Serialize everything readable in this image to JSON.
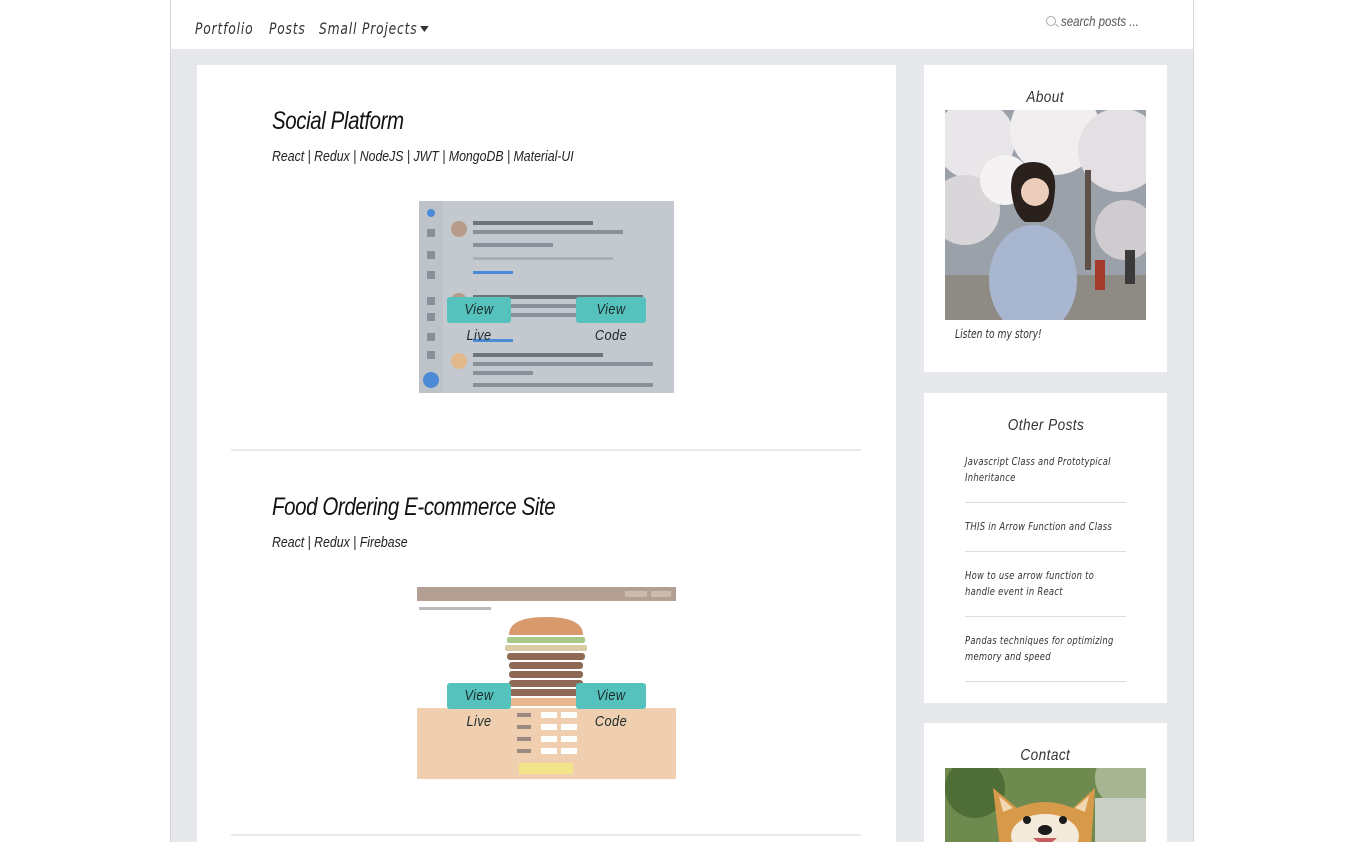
{
  "nav": {
    "items": [
      "Portfolio",
      "Posts",
      "Small Projects"
    ],
    "search_placeholder": "search posts ..."
  },
  "projects": [
    {
      "title": "Social Platform",
      "tech": "React | Redux | NodeJS | JWT | MongoDB | Material-UI",
      "view_live": "View Live",
      "view_code": "View Code"
    },
    {
      "title": "Food Ordering E-commerce Site",
      "tech": "React | Redux | Firebase",
      "view_live": "View Live",
      "view_code": "View Code"
    }
  ],
  "sidebar": {
    "about": {
      "title": "About",
      "link": "Listen to my story!"
    },
    "other_posts": {
      "title": "Other Posts",
      "items": [
        "Javascript Class and Prototypical Inheritance",
        "THIS in Arrow Function and Class",
        "How to use arrow function to handle event in React",
        "Pandas techniques for optimizing memory and speed"
      ]
    },
    "contact": {
      "title": "Contact"
    }
  },
  "colors": {
    "accent": "#56c2bd",
    "background": "#e6e8ec"
  }
}
